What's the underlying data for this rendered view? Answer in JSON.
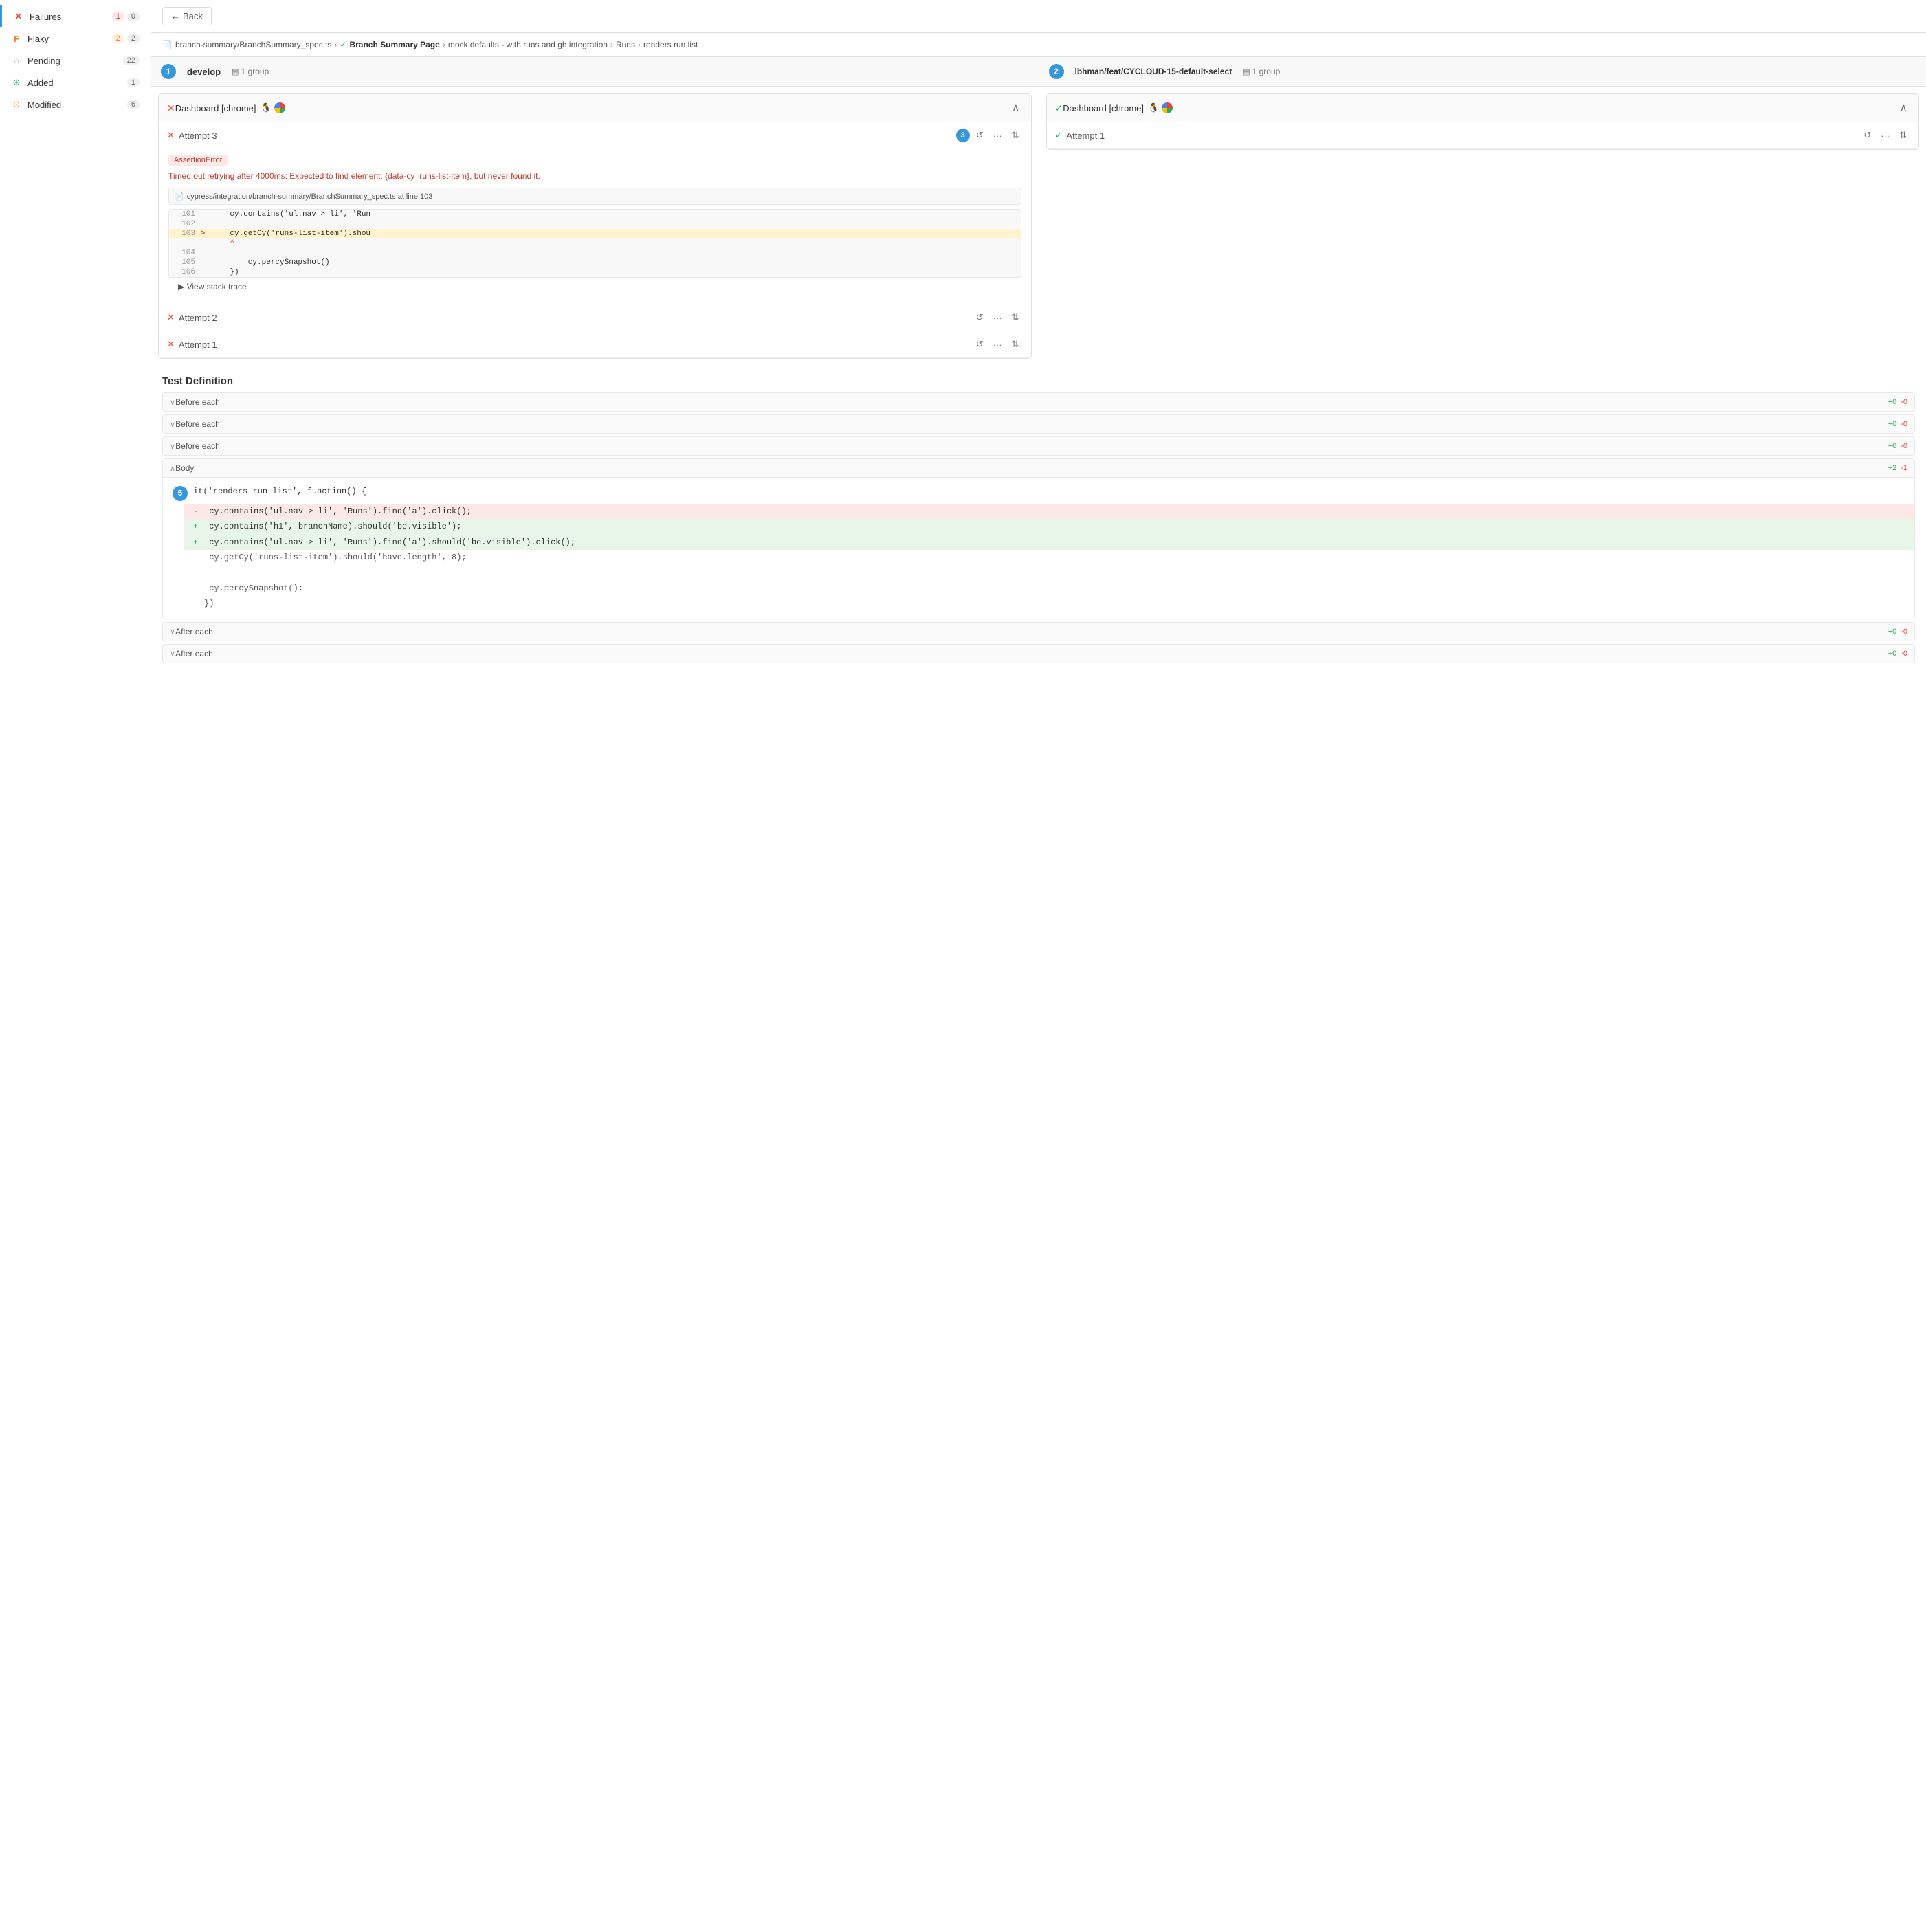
{
  "sidebar": {
    "items": [
      {
        "id": "failures",
        "label": "Failures",
        "icon": "x-circle",
        "count_badge": "1",
        "count_plain": "0",
        "active": true
      },
      {
        "id": "flaky",
        "label": "Flaky",
        "icon": "flaky",
        "count_badge": "2",
        "count_plain": "2"
      },
      {
        "id": "pending",
        "label": "Pending",
        "icon": "pending",
        "count_plain": "22"
      },
      {
        "id": "added",
        "label": "Added",
        "icon": "added",
        "count_plain": "1"
      },
      {
        "id": "modified",
        "label": "Modified",
        "icon": "modified",
        "count_plain": "6"
      }
    ]
  },
  "topbar": {
    "back_label": "Back"
  },
  "breadcrumb": {
    "file": "branch-summary/BranchSummary_spec.ts",
    "page": "Branch Summary Page",
    "context": "mock defaults - with runs and gh integration",
    "section": "Runs",
    "test": "renders run list"
  },
  "columns": [
    {
      "id": "col1",
      "step": "1",
      "branch": "develop",
      "group_label": "1 group",
      "browser_card": {
        "status": "fail",
        "title": "Dashboard [chrome]",
        "attempts": [
          {
            "id": "attempt3",
            "step": "3",
            "status": "fail",
            "label": "Attempt 3",
            "expanded": true,
            "error": {
              "type": "AssertionError",
              "message": "Timed out retrying after 4000ms: Expected to find element: {data-cy=runs-list-item}, but never found it."
            },
            "code_file": "cypress/integration/branch-summary/BranchSummary_spec.ts at line 103",
            "code_lines": [
              {
                "num": "101",
                "arrow": "",
                "content": "    cy.contains('ul.nav > li', 'Run"
              },
              {
                "num": "102",
                "arrow": "",
                "content": ""
              },
              {
                "num": "103",
                "arrow": ">",
                "content": "    cy.getCy('runs-list-item').shou",
                "highlighted": true
              },
              {
                "num": "",
                "arrow": "",
                "content": "    ^",
                "caret": true
              },
              {
                "num": "104",
                "arrow": "",
                "content": ""
              },
              {
                "num": "105",
                "arrow": "",
                "content": "        cy.percySnapshot()"
              },
              {
                "num": "106",
                "arrow": "",
                "content": "    })"
              }
            ],
            "view_stack": "View stack trace"
          },
          {
            "id": "attempt2",
            "status": "fail",
            "label": "Attempt 2",
            "expanded": false
          },
          {
            "id": "attempt1",
            "status": "fail",
            "label": "Attempt 1",
            "expanded": false
          }
        ]
      }
    },
    {
      "id": "col2",
      "step": "2",
      "branch": "lbhman/feat/CYCLOUD-15-default-select",
      "group_label": "1 group",
      "browser_card": {
        "status": "pass",
        "title": "Dashboard [chrome]",
        "attempts": [
          {
            "id": "attempt1-col2",
            "status": "pass",
            "label": "Attempt 1",
            "expanded": false
          }
        ]
      }
    }
  ],
  "test_definition": {
    "title": "Test Definition",
    "rows": [
      {
        "label": "Before each",
        "expanded": false,
        "diff_add": "+0",
        "diff_remove": "-0"
      },
      {
        "label": "Before each",
        "expanded": false,
        "diff_add": "+0",
        "diff_remove": "-0"
      },
      {
        "label": "Before each",
        "expanded": false,
        "diff_add": "+0",
        "diff_remove": "-0"
      },
      {
        "label": "Body",
        "expanded": true,
        "diff_add": "+2",
        "diff_remove": "-1"
      }
    ],
    "body_code": {
      "header_line": "it('renders run list', function() {",
      "lines": [
        {
          "type": "removed",
          "content": "    cy.contains('ul.nav > li', 'Runs').find('a').click();"
        },
        {
          "type": "added",
          "content": "    cy.contains('h1', branchName).should('be.visible');"
        },
        {
          "type": "added",
          "content": "    cy.contains('ul.nav > li', 'Runs').find('a').should('be.visible').click();"
        },
        {
          "type": "neutral",
          "content": "    cy.getCy('runs-list-item').should('have.length', 8);"
        },
        {
          "type": "neutral",
          "content": ""
        },
        {
          "type": "neutral",
          "content": "    cy.percySnapshot();"
        },
        {
          "type": "neutral",
          "content": "})"
        }
      ]
    },
    "after_rows": [
      {
        "label": "After each",
        "expanded": false,
        "diff_add": "+0",
        "diff_remove": "-0"
      },
      {
        "label": "After each",
        "expanded": false,
        "diff_add": "+0",
        "diff_remove": "-0"
      }
    ]
  },
  "icons": {
    "back_arrow": "←",
    "chevron_down": "∨",
    "chevron_up": "∧",
    "ellipsis": "···",
    "expand": "⊞",
    "doc": "📄",
    "check_circle": "✓",
    "replay": "↺",
    "sort": "⇅"
  }
}
